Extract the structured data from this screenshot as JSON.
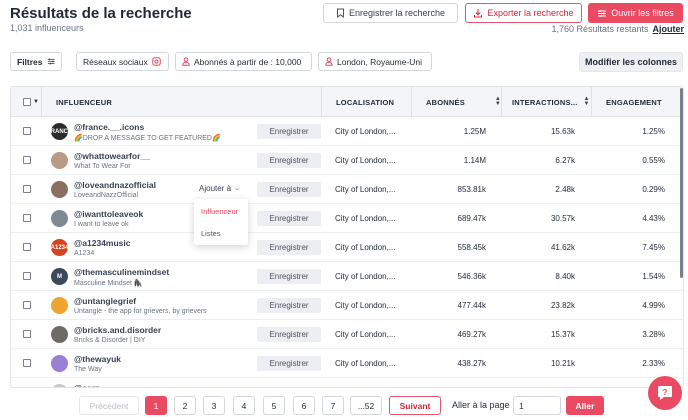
{
  "header": {
    "title": "Résultats de la recherche",
    "count": "1,031 influenceurs",
    "save_search_label": "Enregistrer la recherche",
    "export_label": "Exporter la recherche",
    "open_filters_label": "Ouvrir les filtres",
    "remaining_text": "1,760 Résultats restants",
    "add_link": "Ajouter"
  },
  "filters": {
    "filters_label": "Filtres",
    "social_label": "Réseaux sociaux",
    "followers_label": "Abonnés à partir de : 10,000",
    "location_label": "London, Royaume-Uni",
    "modify_columns_label": "Modifier les colonnes"
  },
  "table": {
    "columns": {
      "influencer": "INFLUENCEUR",
      "location": "LOCALISATION",
      "followers": "ABONNÉS",
      "interactions": "INTERACTIONS...",
      "engagement": "ENGAGEMENT"
    },
    "save_label": "Enregistrer",
    "add_to_label": "Ajouter à",
    "rows": [
      {
        "handle": "@france.__.icons",
        "name": "🌈DROP A MESSAGE TO GET FEATURED🌈",
        "location": "City of London,...",
        "followers": "1.25M",
        "interactions": "15.63k",
        "engagement": "1.25%",
        "avatar_text": "FRANCE",
        "avatar_color": "#2c2c2c"
      },
      {
        "handle": "@whattowearfor__",
        "name": "What To Wear For",
        "location": "City of London,...",
        "followers": "1.14M",
        "interactions": "6.27k",
        "engagement": "0.55%",
        "avatar_text": "",
        "avatar_color": "#b89a86"
      },
      {
        "handle": "@loveandnazofficial",
        "name": "LoveandNazzOfficial",
        "location": "City of London,...",
        "followers": "853.81k",
        "interactions": "2.48k",
        "engagement": "0.29%",
        "avatar_text": "",
        "avatar_color": "#8c6f63"
      },
      {
        "handle": "@iwanttoleaveok",
        "name": "I want to leave ok",
        "location": "City of London,...",
        "followers": "689.47k",
        "interactions": "30.57k",
        "engagement": "4.43%",
        "avatar_text": "",
        "avatar_color": "#7f8a94"
      },
      {
        "handle": "@a1234music",
        "name": "A1234",
        "location": "City of London,...",
        "followers": "558.45k",
        "interactions": "41.62k",
        "engagement": "7.45%",
        "avatar_text": "A1234",
        "avatar_color": "#d4431f"
      },
      {
        "handle": "@themasculinemindset",
        "name": "Masculine Mindset 🦍",
        "location": "City of London,...",
        "followers": "546.36k",
        "interactions": "8.40k",
        "engagement": "1.54%",
        "avatar_text": "M",
        "avatar_color": "#3b4a5a"
      },
      {
        "handle": "@untanglegrief",
        "name": "Untangle - the app for grievers, by grievers",
        "location": "City of London,...",
        "followers": "477.44k",
        "interactions": "23.82k",
        "engagement": "4.99%",
        "avatar_text": "",
        "avatar_color": "#f0a531"
      },
      {
        "handle": "@bricks.and.disorder",
        "name": "Bricks & Disorder | DIY",
        "location": "City of London,...",
        "followers": "469.27k",
        "interactions": "15.37k",
        "engagement": "3.28%",
        "avatar_text": "",
        "avatar_color": "#6e6a66"
      },
      {
        "handle": "@thewayuk",
        "name": "The Way",
        "location": "City of London,...",
        "followers": "438.27k",
        "interactions": "10.21k",
        "engagement": "2.33%",
        "avatar_text": "",
        "avatar_color": "#9a7fd6"
      },
      {
        "handle": "@earp",
        "name": "",
        "location": "",
        "followers": "",
        "interactions": "",
        "engagement": "",
        "avatar_text": "",
        "avatar_color": "#c9c9c9"
      }
    ]
  },
  "dropdown": {
    "items": [
      "Influenceur",
      "Listes"
    ]
  },
  "pagination": {
    "previous": "Précédent",
    "pages": [
      "1",
      "2",
      "3",
      "4",
      "5",
      "6",
      "7",
      "...52"
    ],
    "current": "1",
    "next": "Suivant",
    "goto_label": "Aller à la page",
    "goto_value": "1",
    "go_button": "Aller"
  },
  "colors": {
    "accent": "#ea4b63",
    "header_bg": "#f4f5f8"
  }
}
